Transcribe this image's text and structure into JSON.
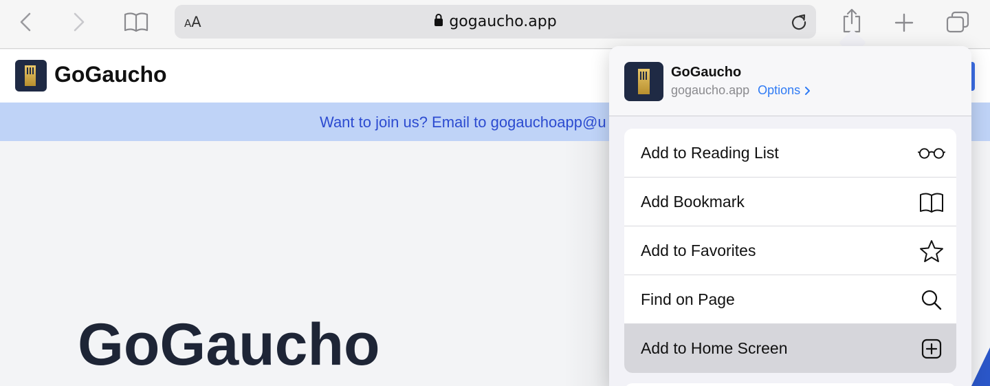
{
  "browser": {
    "text_size_small": "A",
    "text_size_large": "A",
    "url": "gogaucho.app",
    "icons": {
      "back": "chevron-left-icon",
      "forward": "chevron-right-icon",
      "bookmarks": "book-icon",
      "lock": "lock-icon",
      "reload": "reload-icon",
      "share": "share-icon",
      "new_tab": "plus-icon",
      "tabs": "tabs-icon"
    }
  },
  "page": {
    "brand": "GoGaucho",
    "banner": "Want to join us? Email to gogauchoapp@u",
    "hero_title": "GoGaucho"
  },
  "share_sheet": {
    "app_name": "GoGaucho",
    "app_domain": "gogaucho.app",
    "options_label": "Options",
    "actions": [
      {
        "label": "Add to Reading List",
        "icon": "glasses-icon"
      },
      {
        "label": "Add Bookmark",
        "icon": "book-icon"
      },
      {
        "label": "Add to Favorites",
        "icon": "star-icon"
      },
      {
        "label": "Find on Page",
        "icon": "search-icon"
      },
      {
        "label": "Add to Home Screen",
        "icon": "plus-square-icon",
        "highlighted": true
      }
    ]
  },
  "colors": {
    "accent": "#2f7bf5",
    "banner_bg": "#bfd3f7",
    "banner_text": "#2c4bd0",
    "logo_bg": "#1f2a44"
  }
}
